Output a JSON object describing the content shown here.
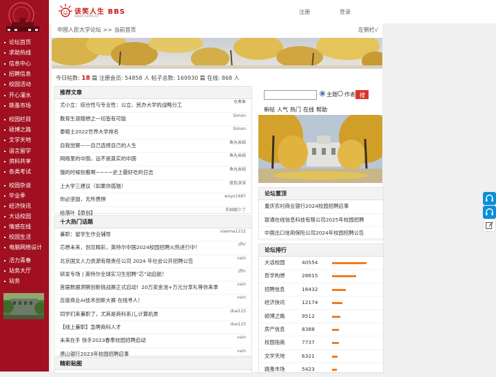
{
  "header": {
    "logo_text": "该笑人生 BBS",
    "logo_url": "www.ruc66.cn",
    "register": "注册",
    "login": "登录"
  },
  "breadcrumb": "中国人民大学论坛 >> 当前首页",
  "sidebar_toggle": "左侧栏√",
  "stats": {
    "today_label": "今日帖数:",
    "today_value": "18",
    "rest": "篇 注册会员: 54858 人 帖子总数: 169930 篇 在线: 868 人"
  },
  "nav": [
    {
      "group": 1,
      "items": [
        "论坛首页",
        "求助热线",
        "信息中心",
        "招聘信息",
        "校园活动",
        "开心灌水",
        "跳蚤市场"
      ]
    },
    {
      "group": 2,
      "items": [
        "校园栏目",
        "硕博之路",
        "文学天地",
        "语言留学",
        "资料共享",
        "各类考试"
      ]
    },
    {
      "group": 3,
      "items": [
        "校园杂谈",
        "毕业季",
        "经济快讯",
        "大话校园",
        "情感在线",
        "校园生活",
        "电脑网络设计"
      ]
    },
    {
      "group": 4,
      "items": [
        "活力青春",
        "站务大厅",
        "站务"
      ]
    }
  ],
  "recommended": {
    "title": "推荐文章",
    "rows": [
      {
        "text": "尤小立：综合性与专业性：公立、民办大学的战略分工",
        "author": "水煮鱼"
      },
      {
        "text": "教育生涯随想之一切皆有可能",
        "author": "Simon"
      },
      {
        "text": "泰晤士2022世界大学排名",
        "author": "Simon"
      },
      {
        "text": "自我觉察——自己选择自己的人生",
        "author": "鱼丸米线"
      },
      {
        "text": "网络里的中国，远不是真实的中国",
        "author": "鱼丸米线"
      },
      {
        "text": "饿的时候别看啊~~~~史上最好吃的日志",
        "author": "鱼丸米线"
      },
      {
        "text": "上大学三建议（如果你孤独）",
        "author": "夜色深深"
      },
      {
        "text": "你必坚固，无所畏惧",
        "author": "woyo1687"
      },
      {
        "text": "给落叶【原创】",
        "author": "灰姑娘少了"
      }
    ]
  },
  "hot": {
    "title": "十大热门话题",
    "rows": [
      {
        "text": "兼职：留学生作业辅导",
        "author": "xiaoma1212"
      },
      {
        "text": "芯想未来，创见精彩，英特尔中国2024校园招聘火热进行中！",
        "author": "zfhr"
      },
      {
        "text": "北京国文人力资源有限责任公司 2024 年社会公开招聘公告",
        "author": "vain"
      },
      {
        "text": "研发专场 | 英特尔全球实习生招聘“芯”动启航！",
        "author": "zfhr"
      },
      {
        "text": "首届数据洞察创新挑战赛正式启动！20万奖金池+万元分享礼等你来拿",
        "author": "vain"
      },
      {
        "text": "百度商业AI技术创新大赛 在线寻人！",
        "author": "vain"
      },
      {
        "text": "同学们来兼职了，尤其是商科系儿,计算机类",
        "author": "due123"
      },
      {
        "text": "【线上兼职】急聘商科人才",
        "author": "due123"
      },
      {
        "text": "未来在手 快手2023春季校园招聘启动",
        "author": "vain"
      },
      {
        "text": "唐山银行2023年校园招聘启事",
        "author": "vain"
      }
    ]
  },
  "featured": {
    "title": "精彩贴图"
  },
  "search": {
    "opt_topic": "主题",
    "opt_author": "作者",
    "button": "搜索"
  },
  "quick_links": [
    "新帖",
    "人气",
    "热门",
    "在线",
    "帮助"
  ],
  "pinned": {
    "title": "论坛置顶",
    "rows": [
      "重庆农村商业银行2024校园招聘启事",
      "联通在线信息科技有限公司2025年校园招聘",
      "中国出口信用保险公司2024年校园招聘公告"
    ]
  },
  "ranking": {
    "title": "论坛排行",
    "rows": [
      {
        "name": "大话校园",
        "value": 40554
      },
      {
        "name": "哲学构想",
        "value": 28615
      },
      {
        "name": "招聘信息",
        "value": 16432
      },
      {
        "name": "经济快讯",
        "value": 12174
      },
      {
        "name": "硕博之路",
        "value": 9512
      },
      {
        "name": "房产信息",
        "value": 8388
      },
      {
        "name": "校园指南",
        "value": 7737
      },
      {
        "name": "文学天地",
        "value": 6321
      },
      {
        "name": "跳蚤市场",
        "value": 5423
      }
    ]
  },
  "colors": {
    "sidebar": "#a01020",
    "accent": "#d01010",
    "bar": "#f27b1c",
    "float": "#0a8fd6"
  }
}
